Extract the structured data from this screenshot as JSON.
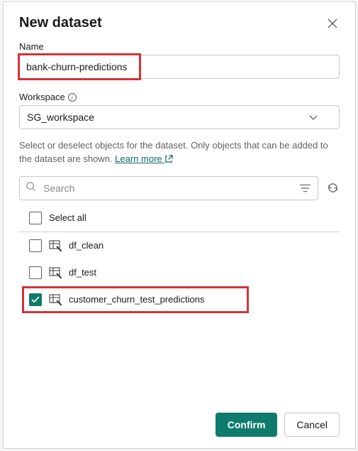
{
  "dialog": {
    "title": "New dataset"
  },
  "name": {
    "label": "Name",
    "value": "bank-churn-predictions"
  },
  "workspace": {
    "label": "Workspace",
    "value": "SG_workspace"
  },
  "helper": {
    "text_a": "Select or deselect objects for the dataset. Only objects that can be added to the dataset are shown. ",
    "learn_more": "Learn more "
  },
  "search": {
    "placeholder": "Search"
  },
  "select_all_label": "Select all",
  "items": [
    {
      "label": "df_clean",
      "checked": false
    },
    {
      "label": "df_test",
      "checked": false
    },
    {
      "label": "customer_churn_test_predictions",
      "checked": true
    }
  ],
  "footer": {
    "confirm": "Confirm",
    "cancel": "Cancel"
  }
}
